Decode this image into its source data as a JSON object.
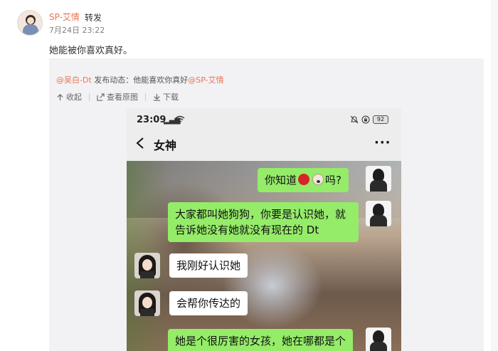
{
  "post": {
    "author": "SP-艾情",
    "action": "转发",
    "time": "7月24日 23:22",
    "text": "她能被你喜欢真好。"
  },
  "repost": {
    "mention_author": "@吴白-Dt",
    "publish_label": " 发布动态：",
    "content": "他能喜欢你真好",
    "mention_target": "@SP-艾情",
    "toolbar": {
      "collapse": "收起",
      "view_original": "查看原图",
      "download": "下载"
    }
  },
  "screenshot": {
    "status": {
      "time": "23:09",
      "signal": "5G",
      "battery": "92"
    },
    "title": "女神",
    "more": "···",
    "messages": [
      {
        "side": "me",
        "text_before": "你知道",
        "emojis": [
          "apple",
          "dog"
        ],
        "text_after": "吗?"
      },
      {
        "side": "me",
        "lines": [
          "大家都叫她狗狗，你要是认识她，就",
          "告诉她没有她就没有现在的 Dt"
        ]
      },
      {
        "side": "other",
        "text": "我刚好认识她"
      },
      {
        "side": "other",
        "text": "会帮你传达的"
      },
      {
        "side": "me",
        "text": "她是个很厉害的女孩，她在哪都是个"
      }
    ]
  },
  "colors": {
    "accent": "#eb7350",
    "repost_bg": "#f2f2f5",
    "bubble_me": "#95ec69",
    "bubble_other": "#ffffff"
  },
  "icons": [
    "collapse-icon",
    "view-original-icon",
    "download-icon",
    "back-icon",
    "wifi-icon",
    "alarm-icon",
    "lock-icon"
  ]
}
